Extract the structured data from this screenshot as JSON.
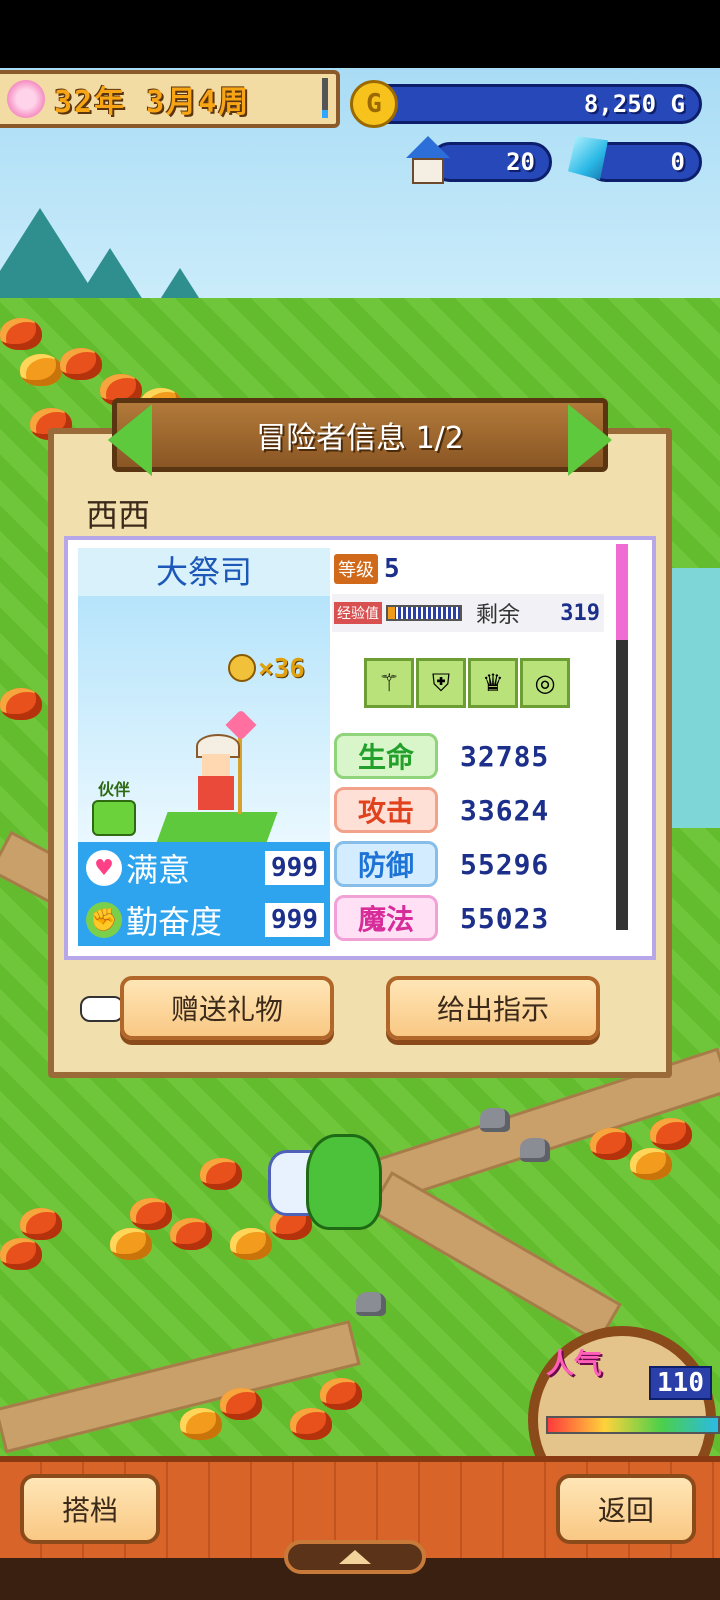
{
  "hud": {
    "date": "32年 3月4周",
    "gold": "8,250 G",
    "gold_icon_letter": "G",
    "houses": "20",
    "gems": "0"
  },
  "dialog": {
    "title": "冒险者信息 1/2",
    "character_name": "西西",
    "class": "大祭司",
    "medal_count": "×36",
    "partner_label": "伙伴",
    "level_label": "等级",
    "level": "5",
    "exp_label": "经验值",
    "exp_progress": 0.1,
    "remaining_label": "剩余",
    "remaining_value": "319",
    "satisfaction_label": "满意",
    "satisfaction_value": "999",
    "diligence_label": "勤奋度",
    "diligence_value": "999",
    "equipment": [
      "staff-icon",
      "armor-icon",
      "crown-icon",
      "ring-icon"
    ],
    "stats": {
      "hp_label": "生命",
      "hp": "32785",
      "atk_label": "攻击",
      "atk": "33624",
      "def_label": "防御",
      "def": "55296",
      "mag_label": "魔法",
      "mag": "55023"
    },
    "gift_button": "赠送礼物",
    "instruct_button": "给出指示"
  },
  "popularity": {
    "label": "人气",
    "value": "110"
  },
  "bottom": {
    "partner_button": "搭档",
    "back_button": "返回"
  },
  "colors": {
    "hud_blue": "#2748b8",
    "panel_beige": "#f2dfae",
    "stat_blue": "#2ea4ef",
    "button_orange": "#f9c884"
  }
}
